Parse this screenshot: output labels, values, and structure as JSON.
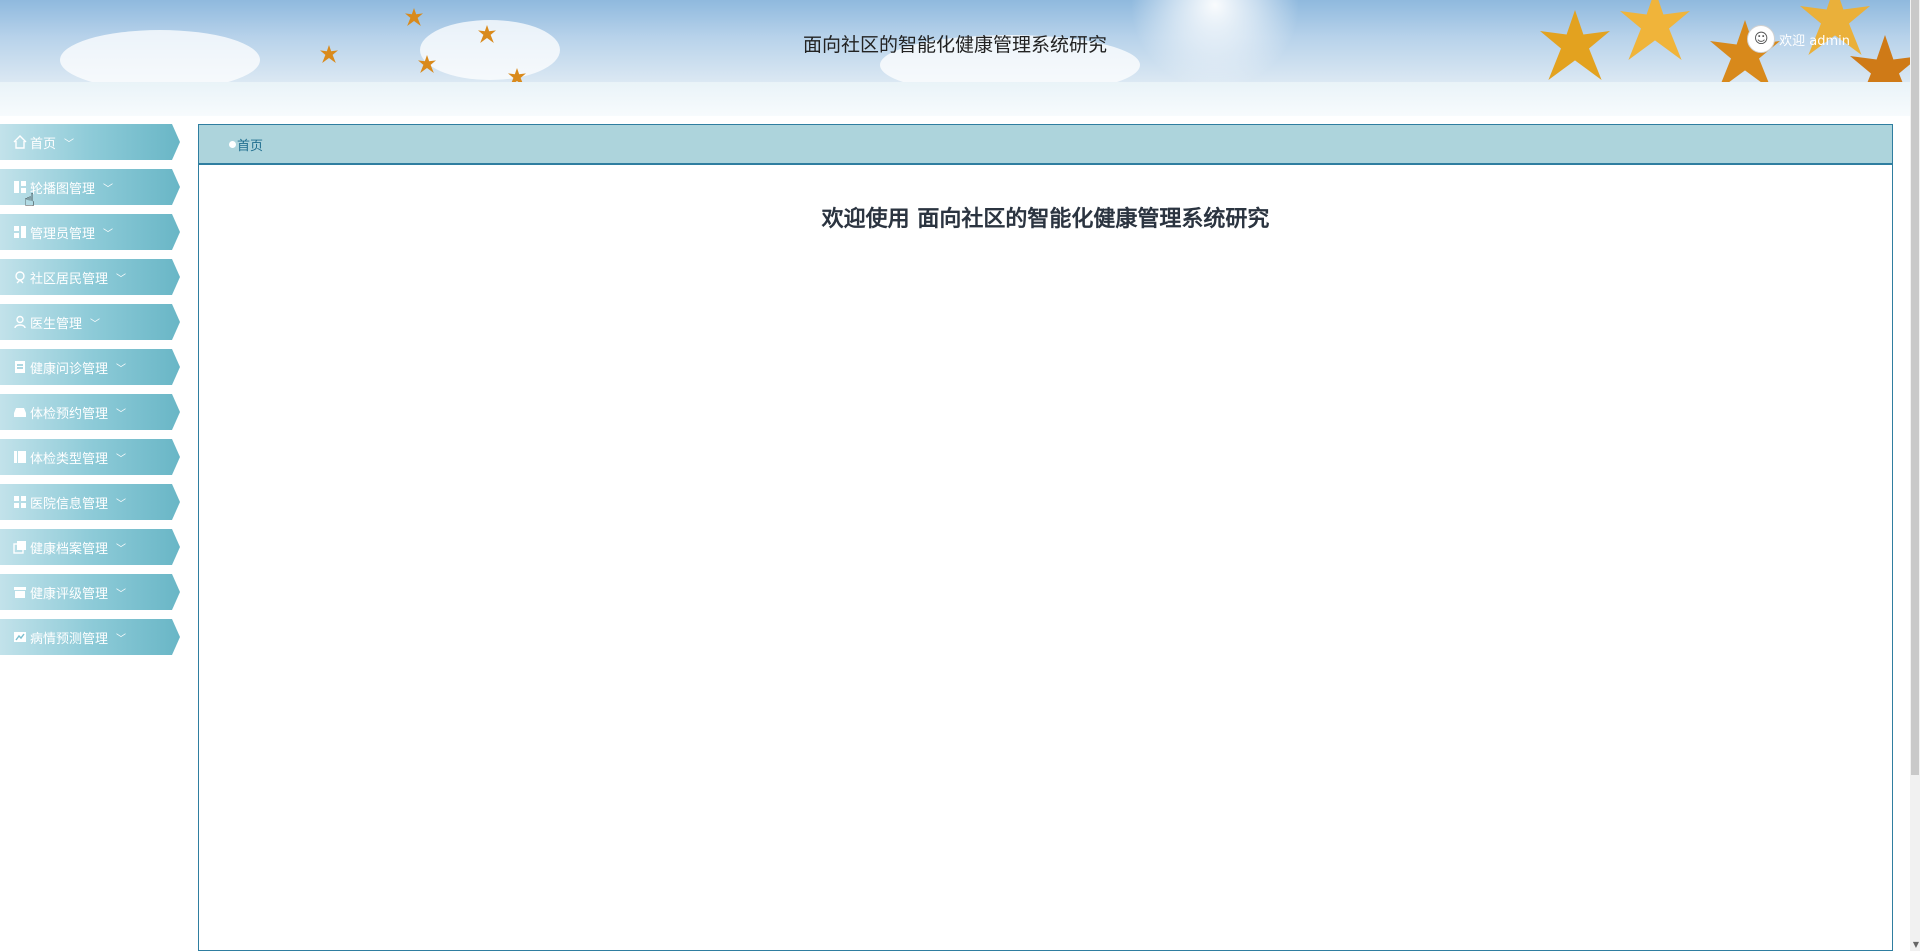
{
  "header": {
    "title": "面向社区的智能化健康管理系统研究",
    "welcome": "欢迎 admin"
  },
  "sidebar": {
    "items": [
      {
        "label": "首页",
        "icon": "home-icon"
      },
      {
        "label": "轮播图管理",
        "icon": "carousel-icon"
      },
      {
        "label": "管理员管理",
        "icon": "admin-icon"
      },
      {
        "label": "社区居民管理",
        "icon": "resident-icon"
      },
      {
        "label": "医生管理",
        "icon": "doctor-icon"
      },
      {
        "label": "健康问诊管理",
        "icon": "consultation-icon"
      },
      {
        "label": "体检预约管理",
        "icon": "appointment-icon"
      },
      {
        "label": "体检类型管理",
        "icon": "exam-type-icon"
      },
      {
        "label": "医院信息管理",
        "icon": "hospital-icon"
      },
      {
        "label": "健康档案管理",
        "icon": "health-record-icon"
      },
      {
        "label": "健康评级管理",
        "icon": "rating-icon"
      },
      {
        "label": "病情预测管理",
        "icon": "prediction-icon"
      }
    ]
  },
  "breadcrumb": {
    "current": "首页"
  },
  "main": {
    "welcome_title": "欢迎使用 面向社区的智能化健康管理系统研究"
  },
  "colors": {
    "accent": "#2f7ea0",
    "menu": "#8ecbd8",
    "breadcrumb_bg": "#add4dc"
  }
}
